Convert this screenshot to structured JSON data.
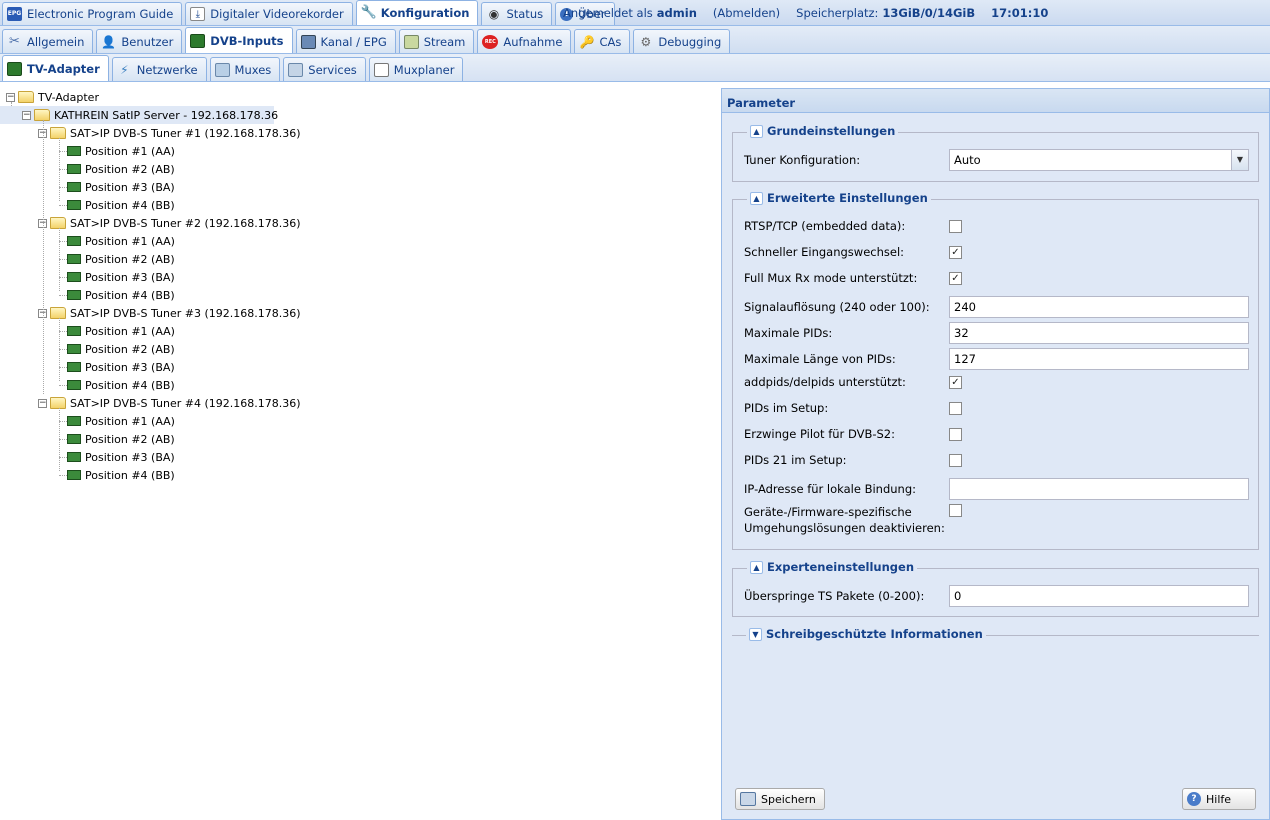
{
  "main_tabs": [
    {
      "label": "Electronic Program Guide",
      "icon": "epg-icon"
    },
    {
      "label": "Digitaler Videorekorder",
      "icon": "dvr-icon"
    },
    {
      "label": "Konfiguration",
      "icon": "wrench-icon",
      "active": true
    },
    {
      "label": "Status",
      "icon": "eye-icon"
    },
    {
      "label": "Über",
      "icon": "info-icon"
    }
  ],
  "status": {
    "logged_in_prefix": "Angemeldet als",
    "user": "admin",
    "logout": "(Abmelden)",
    "storage_label": "Speicherplatz:",
    "storage_value": "13GiB/0/14GiB",
    "time": "17:01:10"
  },
  "config_tabs": [
    {
      "label": "Allgemein",
      "icon": "tools-icon"
    },
    {
      "label": "Benutzer",
      "icon": "user-icon"
    },
    {
      "label": "DVB-Inputs",
      "icon": "dvb-card-icon",
      "active": true
    },
    {
      "label": "Kanal / EPG",
      "icon": "tv-icon"
    },
    {
      "label": "Stream",
      "icon": "stream-icon"
    },
    {
      "label": "Aufnahme",
      "icon": "rec-icon"
    },
    {
      "label": "CAs",
      "icon": "key-icon"
    },
    {
      "label": "Debugging",
      "icon": "bug-icon"
    }
  ],
  "dvb_tabs": [
    {
      "label": "TV-Adapter",
      "icon": "tv-adapter-icon",
      "active": true
    },
    {
      "label": "Netzwerke",
      "icon": "antenna-icon"
    },
    {
      "label": "Muxes",
      "icon": "mux-icon"
    },
    {
      "label": "Services",
      "icon": "services-icon"
    },
    {
      "label": "Muxplaner",
      "icon": "calendar-icon"
    }
  ],
  "tree": {
    "root": "TV-Adapter",
    "server": "KATHREIN SatIP Server - 192.168.178.36",
    "tuners": [
      {
        "label": "SAT>IP DVB-S Tuner #1 (192.168.178.36)",
        "positions": [
          "Position #1 (AA)",
          "Position #2 (AB)",
          "Position #3 (BA)",
          "Position #4 (BB)"
        ]
      },
      {
        "label": "SAT>IP DVB-S Tuner #2 (192.168.178.36)",
        "positions": [
          "Position #1 (AA)",
          "Position #2 (AB)",
          "Position #3 (BA)",
          "Position #4 (BB)"
        ]
      },
      {
        "label": "SAT>IP DVB-S Tuner #3 (192.168.178.36)",
        "positions": [
          "Position #1 (AA)",
          "Position #2 (AB)",
          "Position #3 (BA)",
          "Position #4 (BB)"
        ]
      },
      {
        "label": "SAT>IP DVB-S Tuner #4 (192.168.178.36)",
        "positions": [
          "Position #1 (AA)",
          "Position #2 (AB)",
          "Position #3 (BA)",
          "Position #4 (BB)"
        ]
      }
    ]
  },
  "panel": {
    "title": "Parameter",
    "basic": {
      "legend": "Grundeinstellungen",
      "tuner_label": "Tuner Konfiguration:",
      "tuner_value": "Auto"
    },
    "advanced": {
      "legend": "Erweiterte Einstellungen",
      "fields": [
        {
          "label": "RTSP/TCP (embedded data):",
          "type": "checkbox",
          "checked": false
        },
        {
          "label": "Schneller Eingangswechsel:",
          "type": "checkbox",
          "checked": true
        },
        {
          "label": "Full Mux Rx mode unterstützt:",
          "type": "checkbox",
          "checked": true
        },
        {
          "label": "Signalauflösung (240 oder 100):",
          "type": "text",
          "value": "240"
        },
        {
          "label": "Maximale PIDs:",
          "type": "text",
          "value": "32"
        },
        {
          "label": "Maximale Länge von PIDs:",
          "type": "text",
          "value": "127"
        },
        {
          "label": "addpids/delpids unterstützt:",
          "type": "checkbox",
          "checked": true
        },
        {
          "label": "PIDs im Setup:",
          "type": "checkbox",
          "checked": false
        },
        {
          "label": "Erzwinge Pilot für DVB-S2:",
          "type": "checkbox",
          "checked": false
        },
        {
          "label": "PIDs 21 im Setup:",
          "type": "checkbox",
          "checked": false
        },
        {
          "label": "IP-Adresse für lokale Bindung:",
          "type": "text",
          "value": ""
        },
        {
          "label": "Geräte-/Firmware-spezifische Umgehungslösungen deaktivieren:",
          "type": "checkbox",
          "checked": false
        }
      ]
    },
    "expert": {
      "legend": "Experteneinstellungen",
      "skip_label": "Überspringe TS Pakete (0-200):",
      "skip_value": "0"
    },
    "readonly": {
      "legend": "Schreibgeschützte Informationen"
    },
    "save_label": "Speichern",
    "help_label": "Hilfe"
  }
}
